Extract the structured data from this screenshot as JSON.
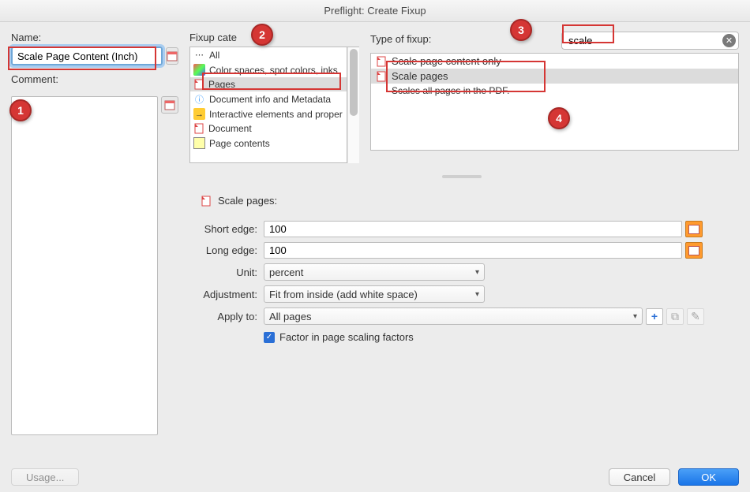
{
  "title": "Preflight: Create Fixup",
  "left": {
    "name_label": "Name:",
    "name_value": "Scale Page Content (Inch)",
    "comment_label": "Comment:"
  },
  "categories": {
    "label": "Fixup cate",
    "items": [
      {
        "icon": "all",
        "label": "All"
      },
      {
        "icon": "color",
        "label": "Color spaces, spot colors, inks"
      },
      {
        "icon": "pdf",
        "label": "Pages",
        "selected": true
      },
      {
        "icon": "doc",
        "label": "Document info and Metadata"
      },
      {
        "icon": "int",
        "label": "Interactive elements and proper"
      },
      {
        "icon": "pdf",
        "label": "Document"
      },
      {
        "icon": "pc",
        "label": "Page contents"
      }
    ]
  },
  "fixup": {
    "type_label": "Type of fixup:",
    "search_value": "scale",
    "items": [
      {
        "label": "Scale page content only"
      },
      {
        "label": "Scale pages",
        "selected": true,
        "desc": "Scales all pages in the PDF."
      }
    ]
  },
  "panel": {
    "title": "Scale pages:",
    "short_edge_label": "Short edge:",
    "short_edge_value": "100",
    "long_edge_label": "Long edge:",
    "long_edge_value": "100",
    "unit_label": "Unit:",
    "unit_value": "percent",
    "adjustment_label": "Adjustment:",
    "adjustment_value": "Fit from inside (add white space)",
    "apply_to_label": "Apply to:",
    "apply_to_value": "All pages",
    "factor_checkbox": "Factor in page scaling factors"
  },
  "footer": {
    "usage": "Usage...",
    "cancel": "Cancel",
    "ok": "OK"
  },
  "callouts": {
    "c1": "1",
    "c2": "2",
    "c3": "3",
    "c4": "4"
  }
}
